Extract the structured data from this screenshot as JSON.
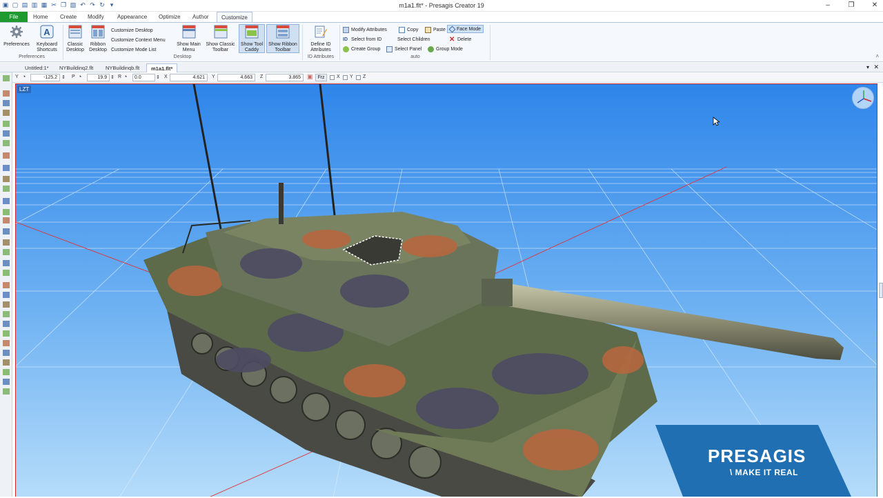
{
  "window": {
    "title": "m1a1.flt* - Presagis Creator 19"
  },
  "ribbon_tabs": [
    "File",
    "Home",
    "Create",
    "Modify",
    "Appearance",
    "Optimize",
    "Author",
    "Customize"
  ],
  "ribbon": {
    "preferences": {
      "label1": "Preferences",
      "label2": "Keyboard",
      "label2b": "Shortcuts",
      "group": "Preferences"
    },
    "desktop": {
      "classic": [
        "Classic",
        "Desktop"
      ],
      "ribbon_desktop": [
        "Ribbon",
        "Desktop"
      ],
      "customize_desktop": "Customize Desktop",
      "customize_context_menu": "Customize Context Menu",
      "customize_mode_list": "Customize Mode List",
      "show_main_menu": [
        "Show Main",
        "Menu"
      ],
      "show_classic_toolbar": [
        "Show Classic",
        "Toolbar"
      ],
      "show_tool_caddy": [
        "Show Tool",
        "Caddy"
      ],
      "show_ribbon_toolbar": [
        "Show Ribbon",
        "Toolbar"
      ],
      "group": "Desktop"
    },
    "id_attributes": {
      "define": [
        "Define ID",
        "Attributes"
      ],
      "group": "ID Attributes"
    },
    "auto": {
      "modify_attributes": "Modify Attributes",
      "copy": "Copy",
      "paste": "Paste",
      "face_mode": "Face Mode",
      "select_from_id": "Select from ID",
      "select_children": "Select Children",
      "delete": "Delete",
      "create_group": "Create Group",
      "select_panel": "Select Panel",
      "group_mode": "Group Mode",
      "group": "auto"
    }
  },
  "doc_tabs": [
    "Untitled:1*",
    "NYBuildinq2.flt",
    "NYBuildinqb.flt",
    "m1a1.flt*"
  ],
  "coords": {
    "y_label": "Y",
    "y_val": "-125.2",
    "p_label": "P",
    "p_val": "19.9",
    "r_label": "R",
    "r_val": "0.0",
    "x_label": "X",
    "x_val": "4.621",
    "y2_label": "Y",
    "y2_val": "4.663",
    "z_label": "Z",
    "z_val": "3.865",
    "frz": "Frz",
    "cx": "X",
    "cy": "Y",
    "cz": "Z"
  },
  "viewport": {
    "badge": "LZT"
  },
  "brand": {
    "name": "PRESAGIS",
    "tagline": "\\ MAKE IT REAL"
  },
  "colors": {
    "file_tab": "#1e9a2e",
    "sky_top": "#2f86ea",
    "sky_bottom": "#b5dcfa",
    "brand": "#1f6fb2"
  }
}
